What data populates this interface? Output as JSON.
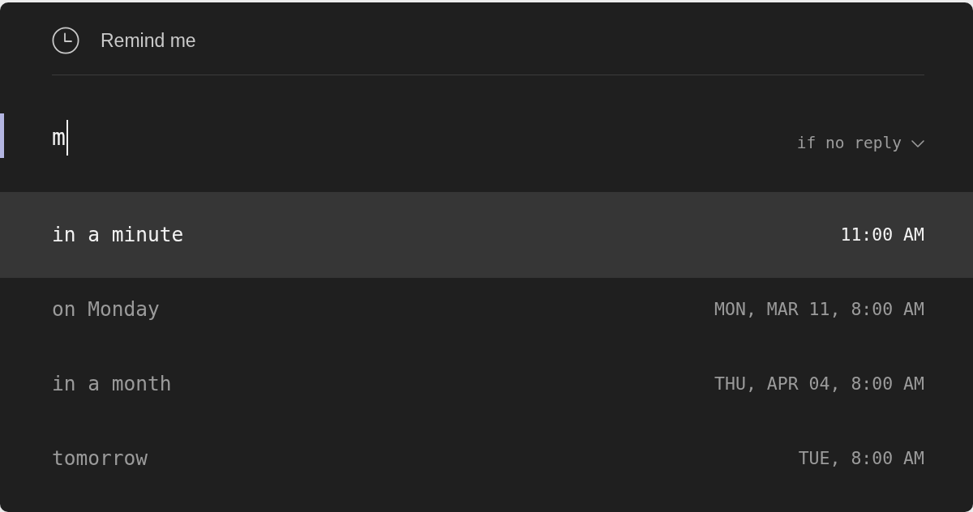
{
  "dialog": {
    "title": "Remind me",
    "input": {
      "value": "m",
      "focused": true
    },
    "condition": {
      "label": "if no reply"
    },
    "options": [
      {
        "label": "in a minute",
        "time": "11:00 AM",
        "selected": true
      },
      {
        "label": "on Monday",
        "time": "MON, MAR 11, 8:00 AM",
        "selected": false
      },
      {
        "label": "in a month",
        "time": "THU, APR 04, 8:00 AM",
        "selected": false
      },
      {
        "label": "tomorrow",
        "time": "TUE, 8:00 AM",
        "selected": false
      }
    ]
  }
}
